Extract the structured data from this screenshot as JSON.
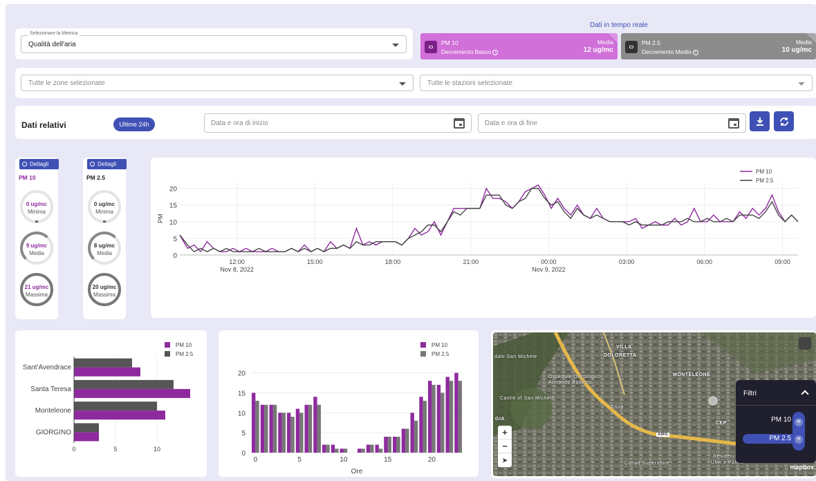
{
  "metric": {
    "label": "Selezionare la Metrica",
    "value": "Qualità dell'aria"
  },
  "realtime": {
    "title": "Dati in tempo reale",
    "pm10": {
      "name": "PM 10",
      "trend": "Decremento Basso",
      "media_label": "Media",
      "media_value": "12 ug/mc",
      "color": "#d070d8"
    },
    "pm25": {
      "name": "PM 2.5",
      "trend": "Decremento Medio",
      "media_label": "Media",
      "media_value": "10 ug/mc",
      "color": "#8c8c8c"
    }
  },
  "filters": {
    "zones_placeholder": "Tutte le zone selezionate",
    "stations_placeholder": "Tutte le stazioni selezionate"
  },
  "dati": {
    "title": "Dati relativi",
    "chip": "Ultime 24h",
    "start_placeholder": "Data e ora di inizio",
    "end_placeholder": "Data e ora di fine"
  },
  "stats": [
    {
      "button": "Dettagli",
      "name": "PM 10",
      "min_value": "0 ug/mc",
      "min_label": "Minima",
      "avg_value": "9 ug/mc",
      "avg_label": "Media",
      "max_value": "21 ug/mc",
      "max_label": "Massima",
      "color": "#8e2a9e"
    },
    {
      "button": "Dettagli",
      "name": "PM 2.5",
      "min_value": "0 ug/mc",
      "min_label": "Minima",
      "avg_value": "8 ug/mc",
      "avg_label": "Media",
      "max_value": "20 ug/mc",
      "max_label": "Massima",
      "color": "#333333"
    }
  ],
  "chart_data": [
    {
      "type": "line",
      "ylabel": "PM",
      "ylim": [
        0,
        22
      ],
      "yticks": [
        0,
        5,
        10,
        15,
        20
      ],
      "x_tick_labels": [
        {
          "x": 2,
          "label": "12:00",
          "sub": "Nov 8, 2022"
        },
        {
          "x": 5,
          "label": "15:00",
          "sub": ""
        },
        {
          "x": 8,
          "label": "18:00",
          "sub": ""
        },
        {
          "x": 11,
          "label": "21:00",
          "sub": ""
        },
        {
          "x": 14,
          "label": "00:00",
          "sub": "Nov 9, 2022"
        },
        {
          "x": 17,
          "label": "03:00",
          "sub": ""
        },
        {
          "x": 20,
          "label": "06:00",
          "sub": ""
        },
        {
          "x": 23,
          "label": "09:00",
          "sub": ""
        }
      ],
      "x": [
        -0.2,
        0.1,
        0.35,
        0.6,
        0.85,
        1.1,
        1.35,
        1.6,
        1.85,
        2.1,
        2.35,
        2.6,
        2.85,
        3.1,
        3.35,
        3.6,
        3.85,
        4.1,
        4.35,
        4.6,
        4.85,
        5.1,
        5.35,
        5.6,
        5.85,
        6.1,
        6.35,
        6.6,
        6.85,
        7.1,
        7.35,
        7.6,
        7.85,
        8.1,
        8.35,
        8.6,
        8.85,
        9.1,
        9.35,
        9.6,
        9.85,
        10.1,
        10.35,
        10.6,
        10.85,
        11.1,
        11.35,
        11.6,
        11.85,
        12.1,
        12.35,
        12.6,
        12.85,
        13.1,
        13.35,
        13.6,
        13.85,
        14.1,
        14.35,
        14.6,
        14.85,
        15.1,
        15.35,
        15.6,
        15.85,
        16.1,
        16.35,
        16.6,
        16.85,
        17.1,
        17.35,
        17.6,
        17.85,
        18.1,
        18.35,
        18.6,
        18.85,
        19.1,
        19.35,
        19.6,
        19.85,
        20.1,
        20.35,
        20.6,
        20.85,
        21.1,
        21.35,
        21.6,
        21.85,
        22.1,
        22.35,
        22.6,
        22.85,
        23.1,
        23.35,
        23.6
      ],
      "series": [
        {
          "name": "PM 10",
          "color": "#8e2a9e",
          "values": [
            6,
            2,
            3,
            1,
            4,
            2,
            1,
            1,
            2,
            1,
            2,
            1,
            1,
            1,
            2,
            1,
            1,
            2,
            1,
            3,
            1,
            2,
            1,
            4,
            2,
            3,
            2,
            8,
            3,
            4,
            3,
            4,
            4,
            4,
            3,
            5,
            8,
            6,
            7,
            10,
            6,
            10,
            14,
            14,
            14,
            14,
            14,
            20,
            17,
            17,
            16,
            14,
            16,
            19,
            20,
            21,
            18,
            14,
            17,
            14,
            12,
            15,
            12,
            11,
            14,
            11,
            10,
            10,
            10,
            10,
            11,
            8,
            9,
            10,
            9,
            9,
            11,
            9,
            10,
            14,
            10,
            10,
            12,
            10,
            10,
            10,
            13,
            11,
            14,
            12,
            14,
            18,
            13,
            10,
            12,
            10
          ]
        },
        {
          "name": "PM 2.5",
          "color": "#444444",
          "values": [
            6,
            3,
            1,
            2,
            1,
            2,
            1,
            2,
            1,
            1,
            1,
            1,
            2,
            1,
            1,
            1,
            1,
            2,
            1,
            2,
            1,
            2,
            1,
            2,
            2,
            3,
            2,
            4,
            3,
            3,
            4,
            4,
            4,
            4,
            3,
            5,
            6,
            7,
            9,
            9,
            7,
            10,
            13,
            12,
            14,
            14,
            14,
            18,
            18,
            18,
            15,
            14,
            16,
            17,
            20,
            20,
            17,
            15,
            16,
            13,
            11,
            14,
            12,
            11,
            12,
            11,
            10,
            10,
            10,
            9,
            10,
            9,
            9,
            9,
            9,
            10,
            10,
            10,
            11,
            10,
            10,
            11,
            10,
            10,
            11,
            10,
            12,
            12,
            12,
            11,
            13,
            16,
            12,
            10,
            12,
            10
          ]
        }
      ]
    },
    {
      "type": "bar",
      "orientation": "horizontal",
      "categories": [
        "Sant'Avendrace",
        "Santa Teresa",
        "Monteleone",
        "GIORGINO"
      ],
      "xlim": [
        0,
        15
      ],
      "xticks": [
        0,
        5,
        10
      ],
      "series": [
        {
          "name": "PM 10",
          "color": "#8e2a9e",
          "values": [
            8,
            14,
            11,
            3
          ]
        },
        {
          "name": "PM 2.5",
          "color": "#555555",
          "values": [
            7,
            12,
            10,
            3
          ]
        }
      ]
    },
    {
      "type": "bar",
      "xlabel": "Ore",
      "ylim": [
        0,
        22
      ],
      "yticks": [
        0,
        5,
        10,
        15,
        20
      ],
      "xticks": [
        0,
        5,
        10,
        15,
        20
      ],
      "x": [
        0,
        1,
        2,
        3,
        4,
        5,
        6,
        7,
        8,
        9,
        10,
        11,
        12,
        13,
        14,
        15,
        16,
        17,
        18,
        19,
        20,
        21,
        22,
        23
      ],
      "series": [
        {
          "name": "PM 10",
          "color": "#8e2a9e",
          "values": [
            15,
            12,
            12,
            10,
            10,
            11,
            12,
            14,
            2,
            2,
            1,
            0,
            1,
            2,
            2,
            4,
            4,
            6,
            10,
            14,
            18,
            17,
            19,
            20
          ]
        },
        {
          "name": "PM 2.5",
          "color": "#777777",
          "values": [
            13,
            12,
            12,
            10,
            9,
            10,
            12,
            12,
            2,
            1,
            1,
            0,
            1,
            2,
            1,
            4,
            4,
            6,
            8,
            13,
            17,
            15,
            18,
            18
          ]
        }
      ]
    }
  ],
  "map": {
    "labels": [
      "dale San Michele",
      "Ospedale Oncologico",
      "Armando Businco",
      "VILLA",
      "DOLORETTA",
      "MONTELEONE",
      "Castle of San Michele",
      "Coop",
      "GIA",
      "CEP",
      "Conad Superstore",
      "Residence",
      "Ulivi e Palme",
      "AMS"
    ],
    "filtri_title": "Filtri",
    "filtri_items": [
      "PM 10",
      "PM 2.5"
    ],
    "attribution": "mapbox"
  }
}
